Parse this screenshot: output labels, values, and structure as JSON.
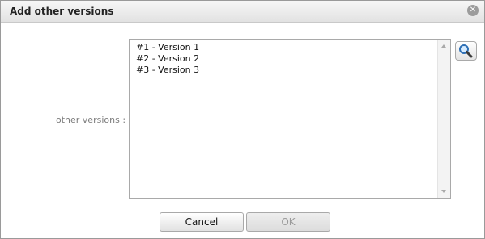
{
  "dialog": {
    "title": "Add other versions",
    "close_icon": "close-icon"
  },
  "form": {
    "label": "other versions :",
    "options": [
      "#1 - Version 1",
      "#2 - Version 2",
      "#3 - Version 3"
    ],
    "search_icon": "magnifier-icon"
  },
  "buttons": {
    "cancel": "Cancel",
    "ok": "OK"
  }
}
